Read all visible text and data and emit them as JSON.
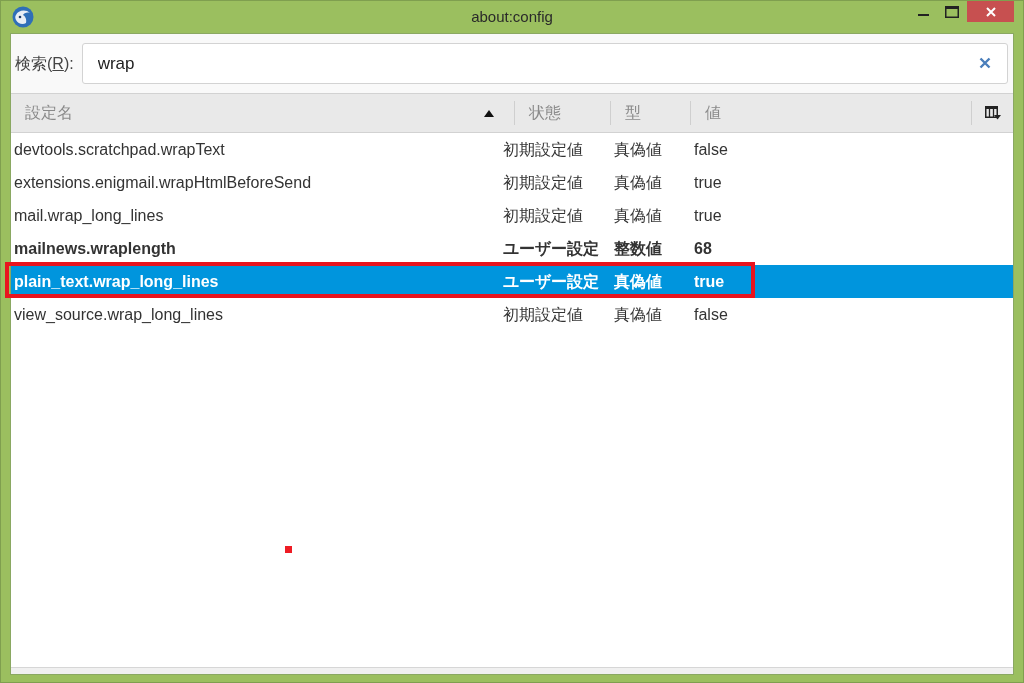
{
  "window": {
    "title": "about:config"
  },
  "search": {
    "label_before": "検索(",
    "access_key": "R",
    "label_after": "):",
    "value": "wrap"
  },
  "table": {
    "columns": [
      {
        "label": "設定名",
        "sorted": true
      },
      {
        "label": "状態",
        "sorted": false
      },
      {
        "label": "型",
        "sorted": false
      },
      {
        "label": "値",
        "sorted": false
      }
    ],
    "rows": [
      {
        "name": "devtools.scratchpad.wrapText",
        "status": "初期設定値",
        "type": "真偽値",
        "value": "false",
        "modified": false,
        "selected": false,
        "highlighted": false
      },
      {
        "name": "extensions.enigmail.wrapHtmlBeforeSend",
        "status": "初期設定値",
        "type": "真偽値",
        "value": "true",
        "modified": false,
        "selected": false,
        "highlighted": false
      },
      {
        "name": "mail.wrap_long_lines",
        "status": "初期設定値",
        "type": "真偽値",
        "value": "true",
        "modified": false,
        "selected": false,
        "highlighted": false
      },
      {
        "name": "mailnews.wraplength",
        "status": "ユーザー設定",
        "type": "整数値",
        "value": "68",
        "modified": true,
        "selected": false,
        "highlighted": false
      },
      {
        "name": "plain_text.wrap_long_lines",
        "status": "ユーザー設定",
        "type": "真偽値",
        "value": "true",
        "modified": true,
        "selected": true,
        "highlighted": true
      },
      {
        "name": "view_source.wrap_long_lines",
        "status": "初期設定値",
        "type": "真偽値",
        "value": "false",
        "modified": false,
        "selected": false,
        "highlighted": false
      }
    ],
    "marker_dot": true
  }
}
